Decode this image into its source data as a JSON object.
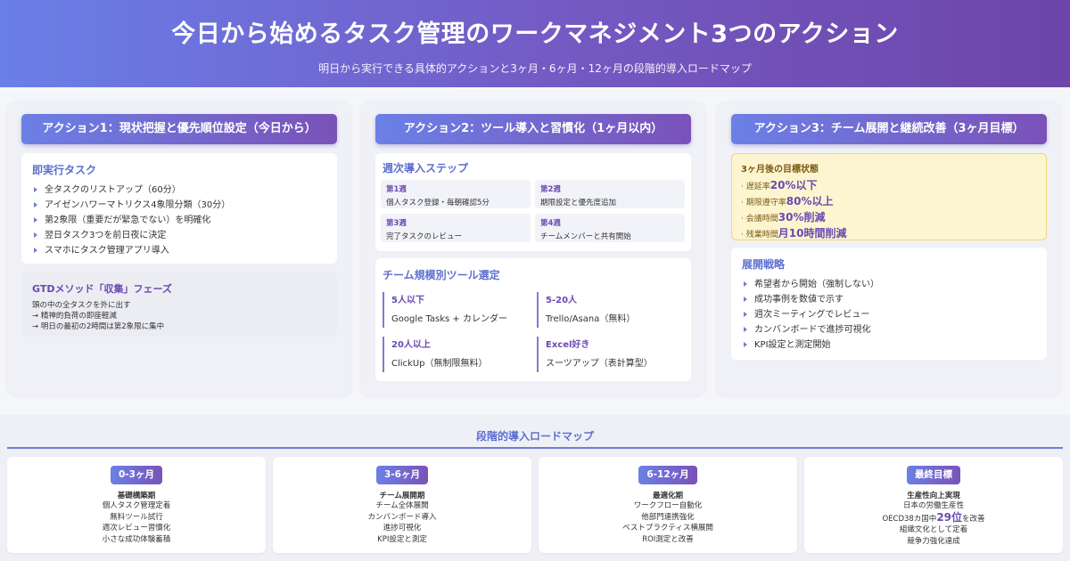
{
  "header": {
    "title": "今日から始めるタスク管理のワークマネジメント3つのアクション",
    "subtitle": "明日から実行できる具体的アクションと3ヶ月・6ヶ月・12ヶ月の段階的導入ロードマップ"
  },
  "action1": {
    "title": "アクション1：現状把握と優先順位設定（今日から）",
    "tasks_title": "即実行タスク",
    "tasks": [
      "全タスクのリストアップ（60分）",
      "アイゼンハワーマトリクス4象限分類（30分）",
      "第2象限（重要だが緊急でない）を明確化",
      "翌日タスク3つを前日夜に決定",
      "スマホにタスク管理アプリ導入"
    ],
    "gtd_title": "GTDメソッド「収集」フェーズ",
    "gtd_lines": [
      "頭の中の全タスクを外に出す",
      "→ 精神的負荷の即座軽減",
      "→ 明日の最初の2時間は第2象限に集中"
    ]
  },
  "action2": {
    "title": "アクション2：ツール導入と習慣化（1ヶ月以内）",
    "weekly_title": "週次導入ステップ",
    "weeks": [
      {
        "label": "第1週",
        "desc": "個人タスク登録・毎朝確認5分"
      },
      {
        "label": "第2週",
        "desc": "期限設定と優先度追加"
      },
      {
        "label": "第3週",
        "desc": "完了タスクのレビュー"
      },
      {
        "label": "第4週",
        "desc": "チームメンバーと共有開始"
      }
    ],
    "tools_title": "チーム規模別ツール選定",
    "tools": [
      {
        "label": "5人以下",
        "desc": "Google Tasks + カレンダー"
      },
      {
        "label": "5-20人",
        "desc": "Trello/Asana（無料）"
      },
      {
        "label": "20人以上",
        "desc": "ClickUp（無制限無料）"
      },
      {
        "label": "Excel好き",
        "desc": "スーツアップ（表計算型）"
      }
    ]
  },
  "action3": {
    "title": "アクション3：チーム展開と継続改善（3ヶ月目標）",
    "goal_title": "3ヶ月後の目標状態",
    "goals": [
      {
        "label": "遅延率",
        "value": "20%以下"
      },
      {
        "label": "期限遵守率",
        "value": "80%以上"
      },
      {
        "label": "会議時間",
        "value": "30%削減"
      },
      {
        "label": "残業時間",
        "value": "月10時間削減"
      }
    ],
    "strategy_title": "展開戦略",
    "strategies": [
      "希望者から開始（強制しない）",
      "成功事例を数値で示す",
      "週次ミーティングでレビュー",
      "カンバンボードで進捗可視化",
      "KPI設定と測定開始"
    ]
  },
  "roadmap": {
    "title": "段階的導入ロードマップ",
    "stages": [
      {
        "badge": "0-3ヶ月",
        "title": "基礎構築期",
        "lines": [
          "個人タスク管理定着",
          "無料ツール試行",
          "週次レビュー習慣化",
          "小さな成功体験蓄積"
        ]
      },
      {
        "badge": "3-6ヶ月",
        "title": "チーム展開期",
        "lines": [
          "チーム全体展開",
          "カンバンボード導入",
          "進捗可視化",
          "KPI設定と測定"
        ]
      },
      {
        "badge": "6-12ヶ月",
        "title": "最適化期",
        "lines": [
          "ワークフロー自動化",
          "他部門連携強化",
          "ベストプラクティス横展開",
          "ROI測定と改善"
        ]
      },
      {
        "badge": "最終目標",
        "title": "生産性向上実現",
        "lines": [
          "日本の労働生産性"
        ],
        "rank_prefix": "OECD38カ国中",
        "rank_value": "29位",
        "rank_suffix": "を改善",
        "lines2": [
          "組織文化として定着",
          "競争力強化達成"
        ]
      }
    ]
  }
}
